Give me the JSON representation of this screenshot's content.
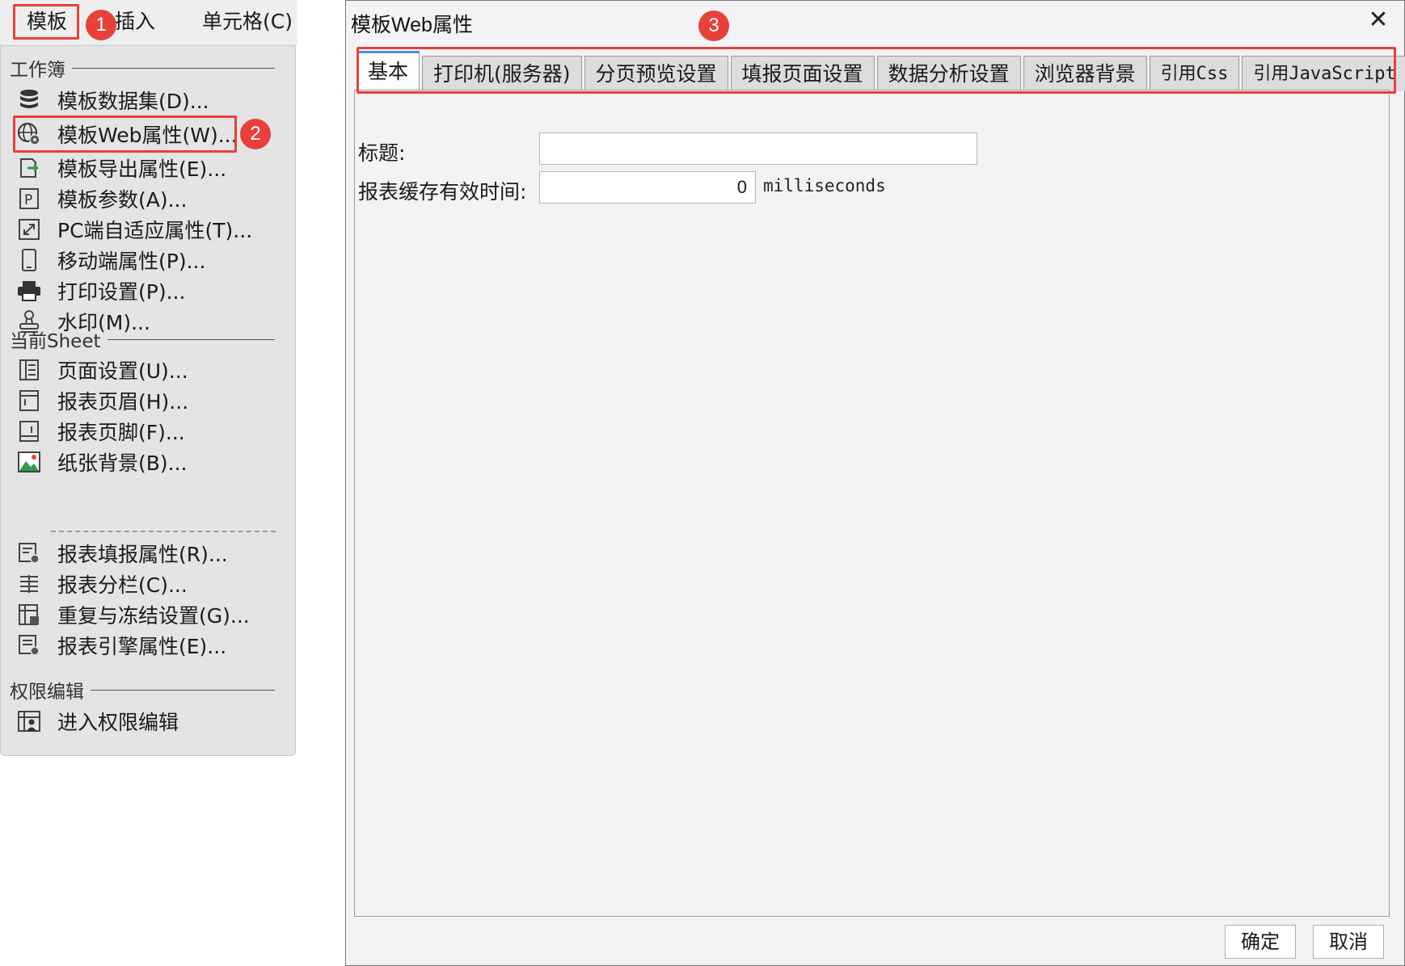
{
  "menubar": {
    "tabs": [
      "模板",
      "插入",
      "单元格(C)"
    ],
    "badges": [
      "1",
      "2",
      "3"
    ]
  },
  "menu": {
    "sections": {
      "workbook": "工作簿",
      "sheet": "当前Sheet",
      "permission": "权限编辑"
    },
    "workbook_items": [
      {
        "label": "模板数据集(D)...",
        "icon": "database-icon"
      },
      {
        "label": "模板Web属性(W)...",
        "icon": "globe-gear-icon"
      },
      {
        "label": "模板导出属性(E)...",
        "icon": "export-icon"
      },
      {
        "label": "模板参数(A)...",
        "icon": "parameter-icon"
      },
      {
        "label": "PC端自适应属性(T)...",
        "icon": "resize-icon"
      },
      {
        "label": "移动端属性(P)...",
        "icon": "mobile-icon"
      },
      {
        "label": "打印设置(P)...",
        "icon": "printer-icon"
      },
      {
        "label": "水印(M)...",
        "icon": "stamp-icon"
      }
    ],
    "sheet_items": [
      {
        "label": "页面设置(U)...",
        "icon": "page-setup-icon"
      },
      {
        "label": "报表页眉(H)...",
        "icon": "header-icon"
      },
      {
        "label": "报表页脚(F)...",
        "icon": "footer-icon"
      },
      {
        "label": "纸张背景(B)...",
        "icon": "image-icon"
      },
      {
        "label": "报表填报属性(R)...",
        "icon": "fill-settings-icon"
      },
      {
        "label": "报表分栏(C)...",
        "icon": "columns-icon"
      },
      {
        "label": "重复与冻结设置(G)...",
        "icon": "freeze-icon"
      },
      {
        "label": "报表引擎属性(E)...",
        "icon": "engine-icon"
      }
    ],
    "permission_items": [
      {
        "label": "进入权限编辑",
        "icon": "permission-icon"
      }
    ]
  },
  "dialog": {
    "title": "模板Web属性",
    "close_symbol": "✕",
    "tabs": [
      "基本",
      "打印机(服务器)",
      "分页预览设置",
      "填报页面设置",
      "数据分析设置",
      "浏览器背景",
      "引用Css",
      "引用JavaScript"
    ],
    "active_tab": "基本",
    "fields": {
      "title_label": "标题:",
      "title_value": "",
      "cache_label": "报表缓存有效时间:",
      "cache_value": "0",
      "cache_unit": "milliseconds"
    },
    "buttons": {
      "ok": "确定",
      "cancel": "取消"
    }
  },
  "colors": {
    "highlight": "#e8403a",
    "active_tab_accent": "#4d8edc",
    "menu_bg": "#e4e4e6",
    "dialog_bg": "#f3f3f5"
  }
}
